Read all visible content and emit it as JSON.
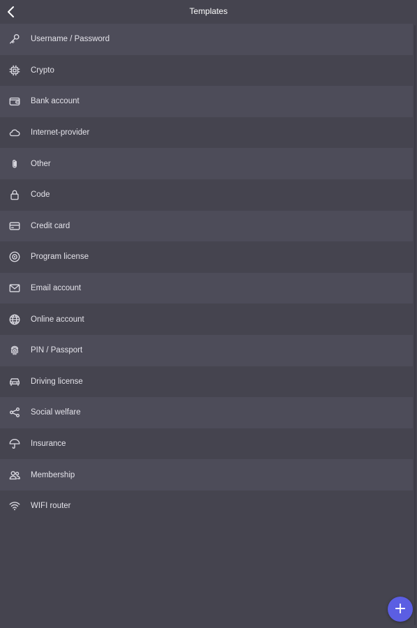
{
  "header": {
    "title": "Templates",
    "back_icon": "chevron-left-icon"
  },
  "templates": [
    {
      "label": "Username / Password",
      "icon": "key-icon"
    },
    {
      "label": "Crypto",
      "icon": "chip-icon"
    },
    {
      "label": "Bank account",
      "icon": "wallet-icon"
    },
    {
      "label": "Internet-provider",
      "icon": "cloud-icon"
    },
    {
      "label": "Other",
      "icon": "paperclip-icon"
    },
    {
      "label": "Code",
      "icon": "lock-icon"
    },
    {
      "label": "Credit card",
      "icon": "credit-card-icon"
    },
    {
      "label": "Program license",
      "icon": "disc-icon"
    },
    {
      "label": "Email account",
      "icon": "envelope-icon"
    },
    {
      "label": "Online account",
      "icon": "globe-icon"
    },
    {
      "label": "PIN / Passport",
      "icon": "fingerprint-icon"
    },
    {
      "label": "Driving license",
      "icon": "car-icon"
    },
    {
      "label": "Social welfare",
      "icon": "share-icon"
    },
    {
      "label": "Insurance",
      "icon": "umbrella-icon"
    },
    {
      "label": "Membership",
      "icon": "people-icon"
    },
    {
      "label": "WIFI router",
      "icon": "wifi-icon"
    }
  ],
  "fab": {
    "label": "+",
    "icon": "plus-icon",
    "color": "#5b5ee3"
  },
  "colors": {
    "background": "#45444f",
    "row_alt": "#4d4c59",
    "text": "#e4e3ea"
  }
}
